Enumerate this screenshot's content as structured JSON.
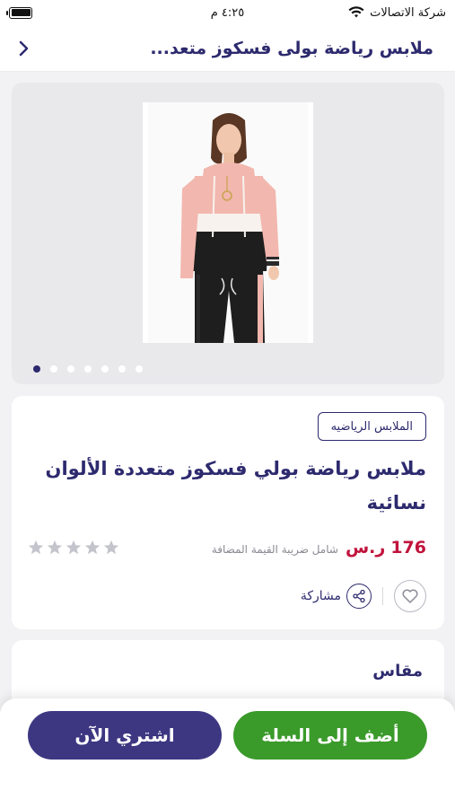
{
  "status_bar": {
    "carrier": "شركة الاتصالات",
    "time": "٤:٢٥ م"
  },
  "header": {
    "title": "ملابس رياضة بولى فسكوز متعد..."
  },
  "gallery": {
    "image_count": 7,
    "active_index": 0,
    "image_description_icon": "product-photo"
  },
  "product": {
    "category": "الملابس الرياضيه",
    "title": "ملابس رياضة بولي فسكوز متعددة الألوان نسائية",
    "price": "176",
    "currency": "ر.س",
    "vat_note": "شامل ضريبة القيمة المضافة",
    "rating": 0,
    "rating_max": 5,
    "share_label": "مشاركة"
  },
  "size_section": {
    "title": "مقاس"
  },
  "bottom": {
    "add_to_cart": "أضف إلى السلة",
    "buy_now": "اشتري الآن"
  },
  "colors": {
    "primary": "#2d2a6e",
    "price": "#c0143c",
    "cart_button": "#3a9a2a",
    "buy_button": "#3d3782",
    "star_empty": "#c4c4cc"
  }
}
